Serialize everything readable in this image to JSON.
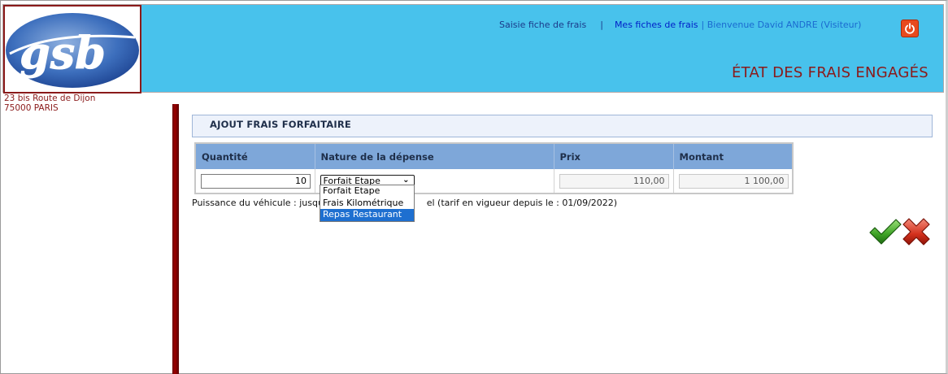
{
  "brand": {
    "logo_text": "gsb",
    "address_line1": "23 bis Route de Dijon",
    "address_line2": "75000 PARIS"
  },
  "nav": {
    "saisie": "Saisie fiche de frais",
    "sep": "|",
    "mes_fiches": "Mes fiches de frais",
    "welcome": "| Bienvenue David ANDRE (Visiteur)"
  },
  "page": {
    "title": "ÉTAT DES FRAIS ENGAGÉS"
  },
  "section": {
    "title": "AJOUT FRAIS FORFAITAIRE"
  },
  "table": {
    "headers": [
      "Quantité",
      "Nature de la dépense",
      "Prix",
      "Montant"
    ],
    "row": {
      "quantite": "10",
      "nature": "Forfait Etape",
      "prix": "110,00",
      "montant": "1 100,00"
    }
  },
  "dropdown": {
    "options": [
      "Forfait Etape",
      "Frais Kilométrique",
      "Repas Restaurant"
    ],
    "highlighted": "Repas Restaurant"
  },
  "notice": {
    "prefix": "Puissance du véhicule : jusqu'à",
    "suffix": "el (tarif en vigueur depuis le : 01/09/2022)"
  },
  "colors": {
    "header_bg": "#48c2ec",
    "title": "#8a1a1a",
    "table_header": "#7ea7d9",
    "select_highlight": "#1e6fd0"
  },
  "icons": {
    "power": "power-icon",
    "validate": "checkmark-icon",
    "cancel": "cross-icon"
  }
}
